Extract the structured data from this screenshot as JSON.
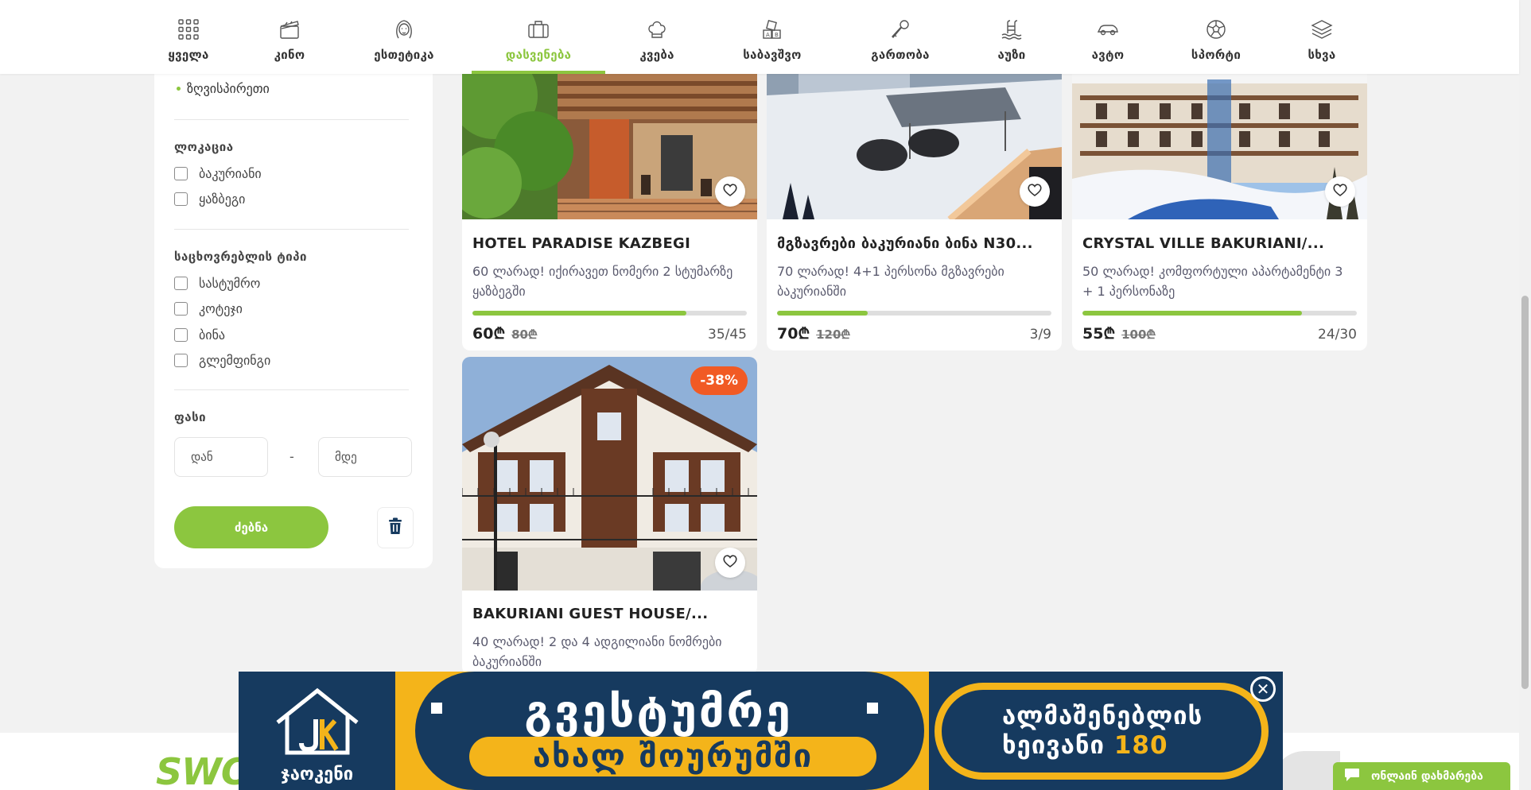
{
  "nav": {
    "items": [
      {
        "label": "ყველა",
        "icon": "grid-icon"
      },
      {
        "label": "კინო",
        "icon": "clapperboard-icon"
      },
      {
        "label": "ესთეტიკა",
        "icon": "woman-face-icon"
      },
      {
        "label": "დასვენება",
        "icon": "suitcase-icon",
        "active": true
      },
      {
        "label": "კვება",
        "icon": "chef-hat-icon"
      },
      {
        "label": "საბავშვო",
        "icon": "toy-blocks-icon"
      },
      {
        "label": "გართობა",
        "icon": "microphone-icon"
      },
      {
        "label": "აუზი",
        "icon": "pool-ladder-icon"
      },
      {
        "label": "ავტო",
        "icon": "car-icon"
      },
      {
        "label": "სპორტი",
        "icon": "soccer-ball-icon"
      },
      {
        "label": "სხვა",
        "icon": "layers-icon"
      }
    ]
  },
  "sidebar": {
    "bullet_item": "ზღვისპირეთი",
    "location": {
      "heading": "ლოკაცია",
      "options": [
        "ბაკურიანი",
        "ყაზბეგი"
      ]
    },
    "accommodation": {
      "heading": "საცხოვრებლის ტიპი",
      "options": [
        "სასტუმრო",
        "კოტეჯი",
        "ბინა",
        "გლემფინგი"
      ]
    },
    "price": {
      "heading": "ფასი",
      "from_placeholder": "დან",
      "to_placeholder": "მდე",
      "dash": "-"
    },
    "search_label": "ძებნა",
    "clear_icon": "trash-icon"
  },
  "cards": [
    {
      "title": "HOTEL PARADISE KAZBEGI",
      "description": "60 ლარად! იქირავეთ ნომერი 2 სტუმარზე ყაზბეგში",
      "price": "60₾",
      "old_price": "80₾",
      "sold": "35/45",
      "progress": 0.78
    },
    {
      "title": "მგზავრები ბაკურიანი ბინა N30...",
      "description": "70 ლარად! 4+1 პერსონა მგზავრები ბაკურიანში",
      "price": "70₾",
      "old_price": "120₾",
      "sold": "3/9",
      "progress": 0.33
    },
    {
      "title": "CRYSTAL VILLE BAKURIANI/...",
      "description": "50 ლარად! კომფორტული აპარტამენტი 3 + 1 პერსონაზე",
      "price": "55₾",
      "old_price": "100₾",
      "sold": "24/30",
      "progress": 0.8
    },
    {
      "title": "BAKURIANI GUEST HOUSE/...",
      "description": "40 ლარად! 2 და 4 ადგილიანი ნომრები ბაკურიანში",
      "discount": "-38%"
    }
  ],
  "banner": {
    "logo_text": "ჯაოკენი",
    "slogan_top": "გვესტუმრე",
    "slogan_bottom": "ახალ შოურუმში",
    "right_line1": "ალმაშენებლის",
    "right_line2_prefix": "ხეივანი",
    "right_line2_number": "180",
    "close_icon": "close-icon"
  },
  "footer": {
    "logo": "SWOO"
  },
  "chat": {
    "label": "ონლაინ დახმარება",
    "icon": "chat-bubble-icon"
  },
  "colors": {
    "accent": "#8cc63f",
    "badge": "#f15a24",
    "banner_navy": "#163a5f",
    "banner_yellow": "#f4b41a"
  }
}
